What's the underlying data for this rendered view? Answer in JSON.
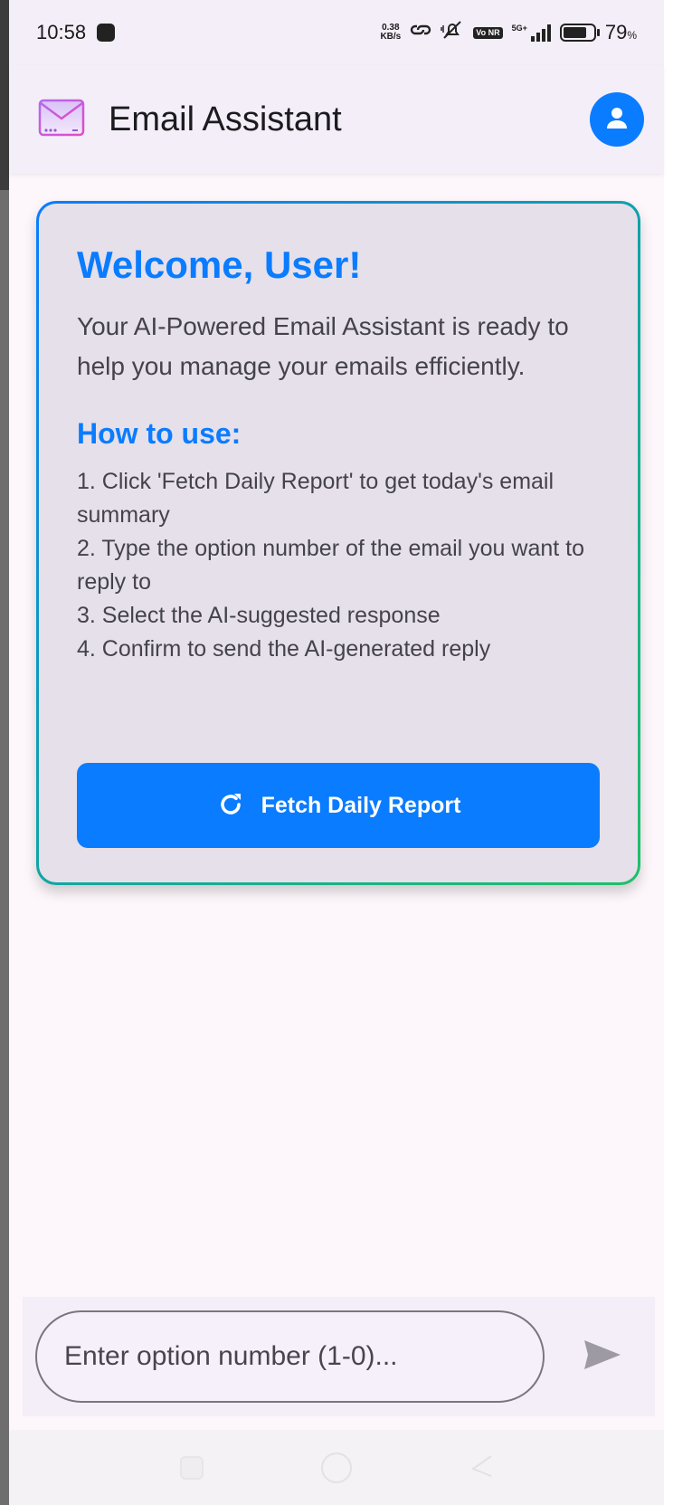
{
  "status_bar": {
    "time": "10:58",
    "net_speed_value": "0.38",
    "net_speed_unit": "KB/s",
    "volte": "Vo NR",
    "signal_label": "5G+",
    "battery_percent": "79",
    "battery_unit": "%",
    "battery_level": 0.79
  },
  "app_bar": {
    "title": "Email Assistant",
    "logo_icon": "mail-icon",
    "account_icon": "account-icon"
  },
  "welcome_card": {
    "title": "Welcome, User!",
    "description": "Your AI-Powered Email Assistant is ready to help you manage your emails efficiently.",
    "howto_title": "How to use:",
    "steps": [
      "1. Click 'Fetch Daily Report' to get today's email summary",
      "2. Type the option number of the email you want to reply to",
      "3. Select the AI-suggested response",
      "4. Confirm to send the AI-generated reply"
    ],
    "fetch_button_label": "Fetch Daily Report",
    "fetch_icon": "refresh-icon"
  },
  "input_bar": {
    "placeholder": "Enter option number (1-0)...",
    "value": "",
    "send_icon": "send-icon"
  },
  "colors": {
    "accent": "#0a7cff",
    "card_border_start": "#0a7cff",
    "card_border_end": "#1fc06a"
  }
}
